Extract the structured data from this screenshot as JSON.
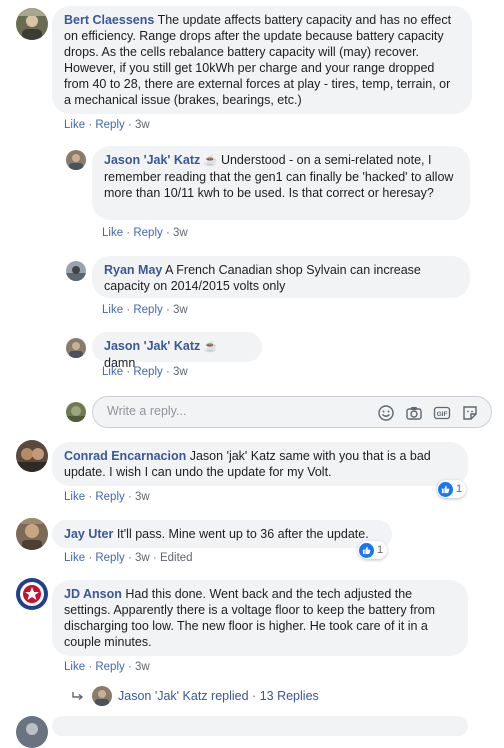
{
  "actions": {
    "like": "Like",
    "reply": "Reply",
    "dot": "·"
  },
  "comments": [
    {
      "author": "Bert Claessens",
      "text": "The update affects battery capacity and has no effect on efficiency. Range drops after the update because battery capacity drops. As the cells rebalance battery capacity will (may) recover. However, if you still get 10kWh per charge and your range dropped from 40 to 28, there are external forces at play - tires, temp, terrain, or a mechanical issue (brakes, bearings, etc.)",
      "time": "3w"
    },
    {
      "author": "Jason 'Jak' Katz",
      "badge": "☕",
      "text": "Understood - on a semi-related note, I remember reading that the gen1 can finally be 'hacked' to allow more than 10/11 kwh to be used. Is that correct or heresay?",
      "time": "3w"
    },
    {
      "author": "Ryan May",
      "text": "A French Canadian shop Sylvain can increase capacity on 2014/2015 volts only",
      "time": "3w"
    },
    {
      "author": "Jason 'Jak' Katz",
      "badge": "☕",
      "text": "damn",
      "time": "3w"
    },
    {
      "author": "Conrad Encarnacion",
      "text": "Jason 'jak' Katz same with you that is a bad update. I wish I can undo the update for my Volt.",
      "time": "3w",
      "reaction_count": "1"
    },
    {
      "author": "Jay Uter",
      "text": "It'll pass. Mine went up to 36 after the update.",
      "time": "3w",
      "edited": "Edited",
      "reaction_count": "1"
    },
    {
      "author": "JD Anson",
      "text": "Had this done. Went back and the tech adjusted the settings. Apparently there is a voltage floor to keep the battery from discharging too low. The new floor is higher. He took care of it in a couple minutes.",
      "time": "3w"
    }
  ],
  "reply_box": {
    "placeholder": "Write a reply..."
  },
  "replies_summary": {
    "author": "Jason 'Jak' Katz",
    "verb": "replied",
    "count": "13 Replies"
  },
  "colors": {
    "link": "#385898",
    "bubble": "#f2f3f5",
    "like": "#1877f2"
  }
}
